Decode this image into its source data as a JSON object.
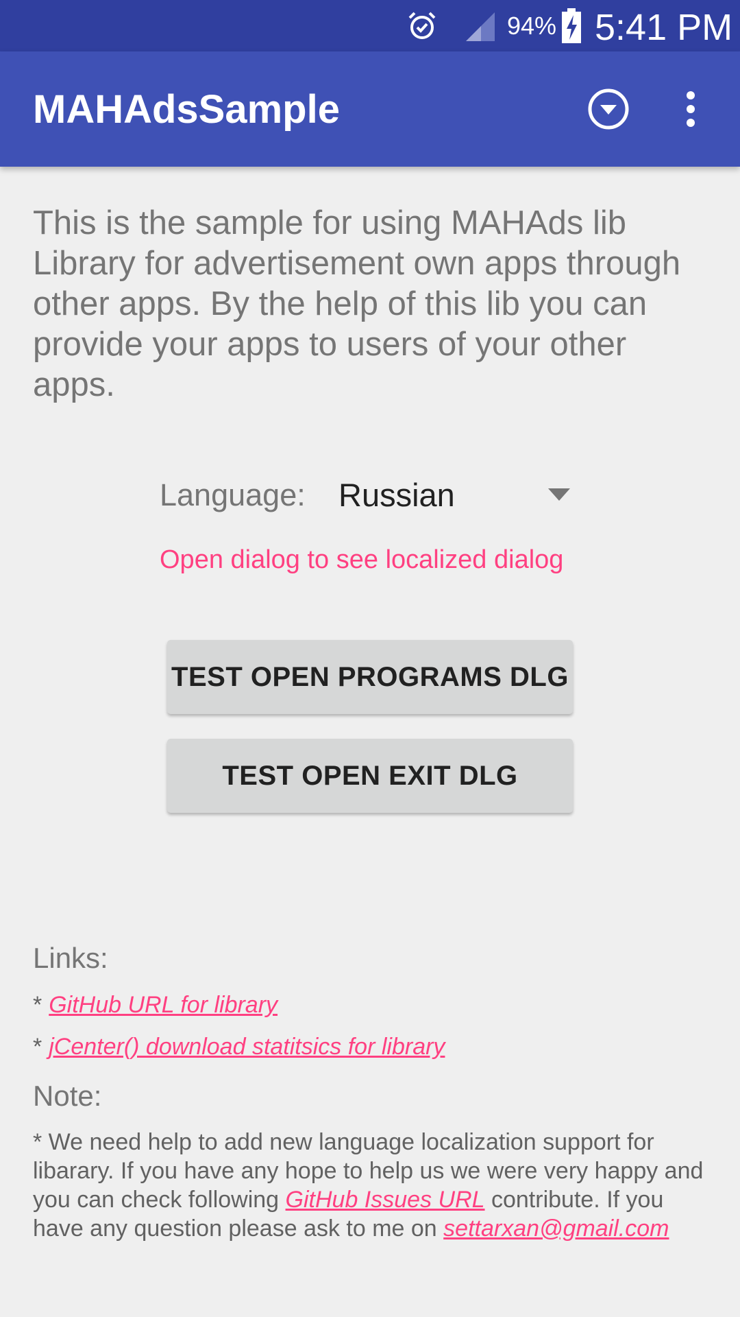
{
  "status_bar": {
    "battery_percent": "94%",
    "time": "5:41 PM",
    "icons": [
      "alarm-icon",
      "signal-icon",
      "battery-charging-icon"
    ]
  },
  "app_bar": {
    "title": "MAHAdsSample",
    "icons": [
      "dropdown-circle-icon",
      "overflow-menu-icon"
    ]
  },
  "intro_text": "This is the sample for using MAHAds lib Library for advertisement own apps through other apps. By the help of this lib you can provide your apps to users of your other apps.",
  "language": {
    "label": "Language:",
    "selected": "Russian"
  },
  "hint": "Open dialog to see localized dialog",
  "buttons": {
    "programs": "TEST OPEN PROGRAMS DLG",
    "exit": "TEST OPEN EXIT DLG"
  },
  "links": {
    "heading": "Links:",
    "bullet": "*",
    "items": [
      {
        "label": "GitHub URL for library"
      },
      {
        "label": "jCenter() download statitsics for library"
      }
    ]
  },
  "note": {
    "heading": "Note:",
    "text_before": "* We need help to add new language localization support for libarary. If you have any hope to help us we were very happy and you can check following ",
    "issues_link": "GitHub Issues URL",
    "text_after": " contribute. If you have any question please ask to me on ",
    "email": "settarxan@gmail.com"
  },
  "colors": {
    "status_bar": "#303f9f",
    "app_bar": "#3f51b5",
    "accent": "#ff4081",
    "background": "#efefef",
    "button": "#d6d7d7"
  }
}
